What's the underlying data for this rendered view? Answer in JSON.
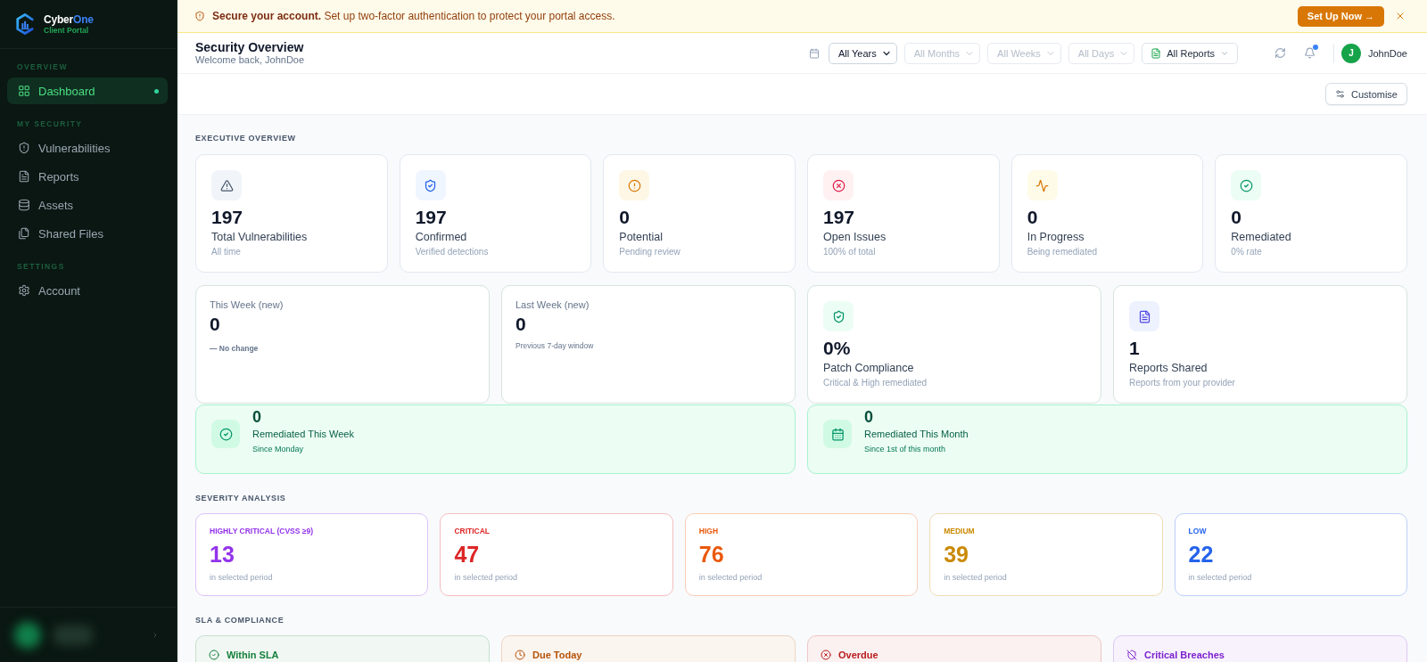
{
  "banner": {
    "message": "**Secure your account.** Set up two-factor authentication to protect your portal access.",
    "action": "Set Up Now →"
  },
  "sidebar": {
    "brand": {
      "name": "Cyber",
      "name_accent": "One",
      "subtitle": "Client Portal"
    },
    "sections": [
      {
        "label": "OVERVIEW",
        "items": [
          {
            "label": "Dashboard",
            "selected": true
          }
        ]
      },
      {
        "label": "MY SECURITY",
        "items": [
          {
            "label": "Vulnerabilities",
            "selected": false
          },
          {
            "label": "Reports",
            "selected": false
          },
          {
            "label": "Assets",
            "selected": false
          },
          {
            "label": "Shared Files",
            "selected": false
          }
        ]
      },
      {
        "label": "SETTINGS",
        "items": [
          {
            "label": "Account",
            "selected": false
          }
        ]
      }
    ]
  },
  "header": {
    "title": "Security Overview",
    "subtitle": "Welcome back, JohnDoe",
    "filters": [
      {
        "value": "All Years",
        "disabled": false
      },
      {
        "value": "All Months",
        "disabled": true
      },
      {
        "value": "All Weeks",
        "disabled": true
      },
      {
        "value": "All Days",
        "disabled": true
      }
    ],
    "report_filter": {
      "value": "All Reports"
    },
    "notifications": {
      "unread": true
    },
    "user": {
      "initial": "J",
      "name": "JohnDoe"
    }
  },
  "toolbar": {
    "customise": "Customise"
  },
  "executive_overview": {
    "title": "EXECUTIVE OVERVIEW",
    "stats": [
      {
        "value": "197",
        "label": "Total Vulnerabilities",
        "note": "All time"
      },
      {
        "value": "197",
        "label": "Confirmed",
        "note": "Verified detections"
      },
      {
        "value": "0",
        "label": "Potential",
        "note": "Pending review"
      },
      {
        "value": "197",
        "label": "Open Issues",
        "note": "100% of total"
      },
      {
        "value": "0",
        "label": "In Progress",
        "note": "Being remediated"
      },
      {
        "value": "0",
        "label": "Remediated",
        "note": "0% rate"
      }
    ],
    "weekly": [
      {
        "label": "This Week (new)",
        "value": "0",
        "trend": "— No change"
      },
      {
        "label": "Last Week (new)",
        "value": "0",
        "note": "Previous 7-day window"
      }
    ],
    "highlights": [
      {
        "value": "0%",
        "label": "Patch Compliance",
        "note": "Critical & High remediated"
      },
      {
        "value": "1",
        "label": "Reports Shared",
        "note": "Reports from your provider"
      }
    ],
    "remediated": [
      {
        "value": "0",
        "label": "Remediated This Week",
        "note": "Since Monday"
      },
      {
        "value": "0",
        "label": "Remediated This Month",
        "note": "Since 1st of this month"
      }
    ]
  },
  "severity_analysis": {
    "title": "SEVERITY ANALYSIS",
    "levels": [
      {
        "label": "HIGHLY CRITICAL (CVSS ≥9)",
        "value": "13",
        "note": "in selected period",
        "color": "#9333ea"
      },
      {
        "label": "CRITICAL",
        "value": "47",
        "note": "in selected period",
        "color": "#dc2626"
      },
      {
        "label": "HIGH",
        "value": "76",
        "note": "in selected period",
        "color": "#ea580c"
      },
      {
        "label": "MEDIUM",
        "value": "39",
        "note": "in selected period",
        "color": "#ca8a04"
      },
      {
        "label": "LOW",
        "value": "22",
        "note": "in selected period",
        "color": "#2563eb"
      }
    ]
  },
  "sla_compliance": {
    "title": "SLA & COMPLIANCE",
    "cards": [
      {
        "title": "Within SLA",
        "color": "#15803d"
      },
      {
        "title": "Due Today",
        "color": "#b45309"
      },
      {
        "title": "Overdue",
        "color": "#b91c1c"
      },
      {
        "title": "Critical Breaches",
        "color": "#7e22ce"
      }
    ]
  }
}
